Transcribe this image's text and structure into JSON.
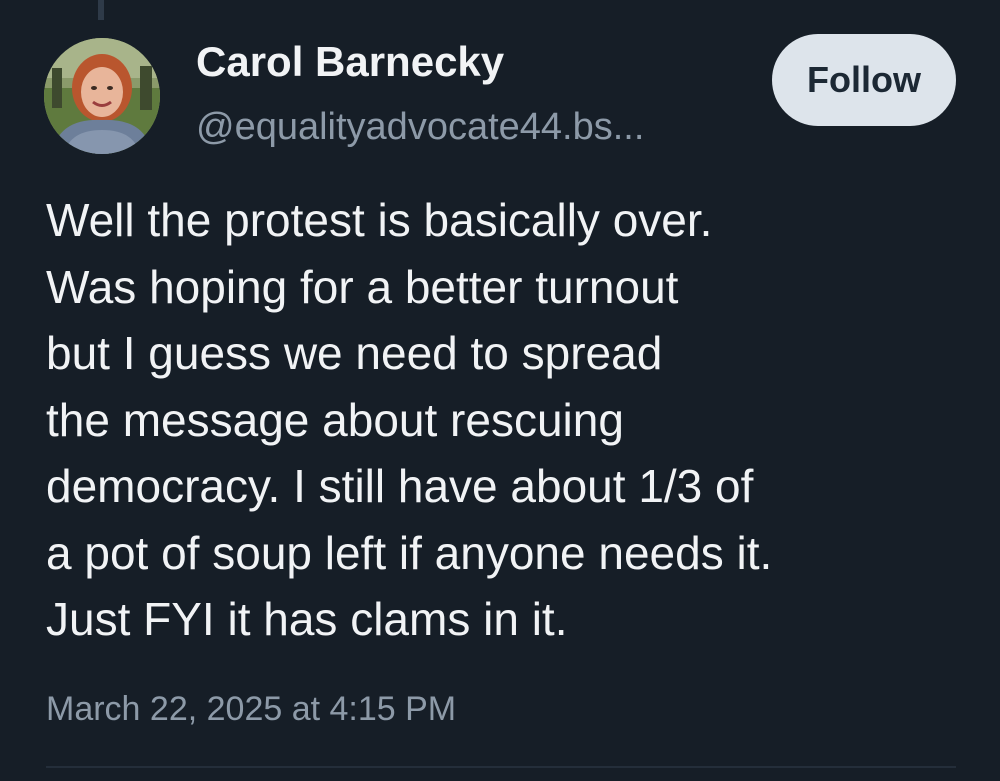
{
  "author": {
    "name": "Carol Barnecky",
    "handle": "@equalityadvocate44.bs..."
  },
  "actions": {
    "follow_label": "Follow"
  },
  "post": {
    "lines": [
      "Well the protest is basically over.",
      "Was hoping for a better turnout",
      "but I guess we need to spread",
      "the message about rescuing",
      "democracy. I still have about 1/3 of",
      "a pot of soup left if anyone needs it.",
      "Just FYI it has clams in it."
    ],
    "timestamp": "March 22, 2025 at 4:15 PM"
  },
  "colors": {
    "background": "#161e27",
    "text_primary": "#f1f3f5",
    "text_secondary": "#8d9aa8",
    "follow_button_bg": "#dde4eb"
  }
}
